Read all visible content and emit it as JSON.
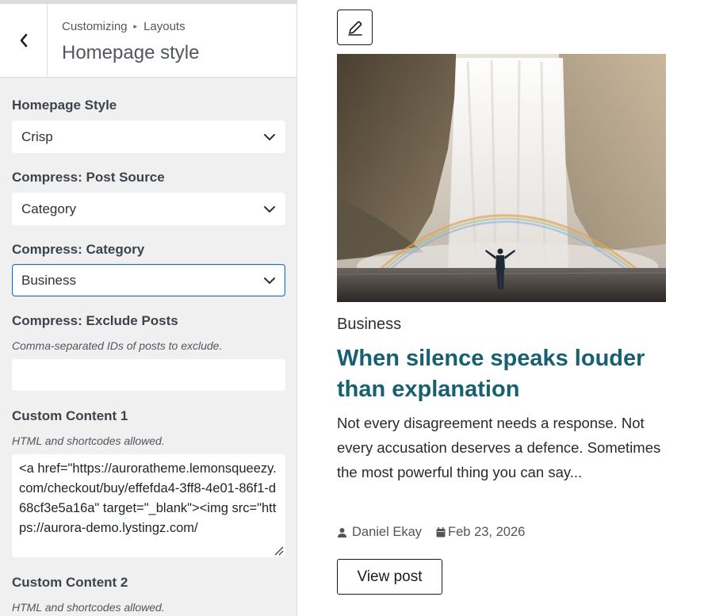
{
  "header": {
    "breadcrumb_root": "Customizing",
    "breadcrumb_current": "Layouts",
    "section_title": "Homepage style"
  },
  "controls": {
    "homepage_style": {
      "label": "Homepage Style",
      "value": "Crisp"
    },
    "post_source": {
      "label": "Compress: Post Source",
      "value": "Category"
    },
    "category": {
      "label": "Compress: Category",
      "value": "Business"
    },
    "exclude_posts": {
      "label": "Compress: Exclude Posts",
      "description": "Comma-separated IDs of posts to exclude.",
      "value": ""
    },
    "custom_content_1": {
      "label": "Custom Content 1",
      "description": "HTML and shortcodes allowed.",
      "value": "<a href=\"https://auroratheme.lemonsqueezy.com/checkout/buy/effefda4-3ff8-4e01-86f1-d68cf3e5a16a\" target=\"_blank\"><img src=\"https://aurora-demo.lystingz.com/"
    },
    "custom_content_2": {
      "label": "Custom Content 2",
      "description": "HTML and shortcodes allowed."
    }
  },
  "preview": {
    "post": {
      "category": "Business",
      "title": "When silence speaks louder than explanation",
      "excerpt": "Not every disagreement needs a response. Not every accusation deserves a defence. Sometimes the most powerful thing you can say...",
      "author": "Daniel Ekay",
      "date": "Feb 23, 2026",
      "button_label": "View post"
    }
  },
  "colors": {
    "accent_title": "#17606f",
    "focus_border": "#2271b1",
    "sidebar_bg": "#f0f0f1"
  },
  "icons": {
    "back": "chevron-left-icon",
    "select": "chevron-down-icon",
    "edit": "pencil-icon",
    "author": "user-icon",
    "date": "calendar-icon"
  }
}
